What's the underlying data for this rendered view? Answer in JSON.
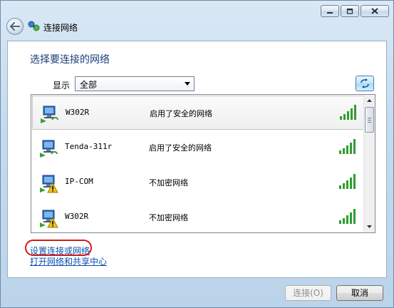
{
  "window": {
    "title": "连接网络"
  },
  "main": {
    "heading": "选择要连接的网络",
    "show_label": "显示",
    "filter_selected": "全部"
  },
  "networks": [
    {
      "name": "W302R",
      "security": "启用了安全的网络",
      "secured": true,
      "selected": true,
      "signal_bars": 5
    },
    {
      "name": "Tenda-311r",
      "security": "启用了安全的网络",
      "secured": true,
      "selected": false,
      "signal_bars": 5
    },
    {
      "name": "IP-COM",
      "security": "不加密网络",
      "secured": false,
      "selected": false,
      "signal_bars": 5
    },
    {
      "name": "W302R",
      "security": "不加密网络",
      "secured": false,
      "selected": false,
      "signal_bars": 5
    }
  ],
  "links": {
    "setup": "设置连接或网络",
    "open_center": "打开网络和共享中心"
  },
  "buttons": {
    "connect": "连接(O)",
    "cancel": "取消"
  },
  "colors": {
    "heading": "#1d3d7a",
    "link": "#0b4fb0",
    "highlight_oval": "#d11a1a",
    "signal_green": "#2f9e2f"
  }
}
